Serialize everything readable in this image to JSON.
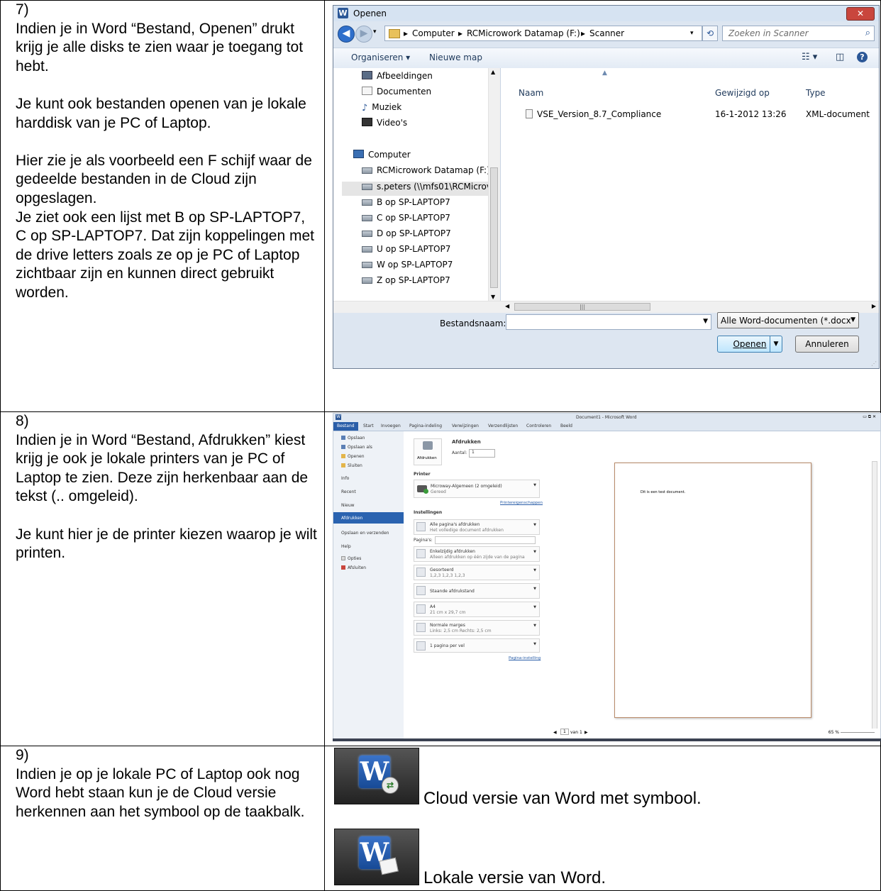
{
  "rows": [
    {
      "number": "7)",
      "paragraphs": [
        "Indien je in Word “Bestand, Openen” drukt krijg je alle disks te zien waar je toegang tot hebt.",
        "Je kunt ook bestanden openen van je lokale harddisk van je PC of Laptop.",
        "Hier zie je als voorbeeld een F schijf waar de gedeelde bestanden in de Cloud zijn opgeslagen.",
        "Je ziet ook een lijst met B op SP-LAPTOP7, C op SP-LAPTOP7. Dat zijn koppelingen met de drive letters zoals ze op je PC of Laptop zichtbaar zijn en kunnen direct gebruikt worden."
      ]
    },
    {
      "number": "8)",
      "paragraphs": [
        "Indien je in Word “Bestand, Afdrukken” kiest krijg je ook je lokale printers van je PC of Laptop te zien. Deze zijn herkenbaar aan de tekst (.. omgeleid).",
        "Je kunt hier je de printer kiezen waarop je wilt printen."
      ]
    },
    {
      "number": "9)",
      "paragraphs": [
        "Indien je op je lokale PC of Laptop ook nog Word hebt staan kun je de Cloud versie herkennen aan het symbool op de taakbalk."
      ]
    }
  ],
  "open_dialog": {
    "app_icon": "W",
    "title": "Openen",
    "close": "✕",
    "breadcrumb": [
      "Computer",
      "RCMicrowork Datamap (F:)",
      "Scanner"
    ],
    "search_placeholder": "Zoeken in Scanner",
    "toolbar": {
      "organize": "Organiseren ▾",
      "new_folder": "Nieuwe map"
    },
    "nav_items": [
      {
        "label": "Afbeeldingen",
        "icon": "pictures-icon"
      },
      {
        "label": "Documenten",
        "icon": "documents-icon"
      },
      {
        "label": "Muziek",
        "icon": "music-icon"
      },
      {
        "label": "Video's",
        "icon": "videos-icon"
      },
      {
        "label": "Computer",
        "icon": "computer-icon"
      },
      {
        "label": "RCMicrowork Datamap (F:)",
        "icon": "network-drive-icon"
      },
      {
        "label": "s.peters (\\\\mfs01\\RCMicrov",
        "icon": "network-drive-icon"
      },
      {
        "label": "B op SP-LAPTOP7",
        "icon": "network-drive-icon"
      },
      {
        "label": "C op SP-LAPTOP7",
        "icon": "network-drive-icon"
      },
      {
        "label": "D op SP-LAPTOP7",
        "icon": "network-drive-icon"
      },
      {
        "label": "U op SP-LAPTOP7",
        "icon": "network-drive-icon"
      },
      {
        "label": "W op SP-LAPTOP7",
        "icon": "network-drive-icon"
      },
      {
        "label": "Z op SP-LAPTOP7",
        "icon": "network-drive-icon"
      }
    ],
    "columns": {
      "name": "Naam",
      "modified": "Gewijzigd op",
      "type": "Type"
    },
    "files": [
      {
        "name": "VSE_Version_8.7_Compliance",
        "modified": "16-1-2012 13:26",
        "type": "XML-document"
      }
    ],
    "filename_label": "Bestandsnaam:",
    "filename_value": "",
    "filter": "Alle Word-documenten (*.docx",
    "open_button": "Openen",
    "cancel_button": "Annuleren"
  },
  "word_print": {
    "window_title": "Document1 - Microsoft Word",
    "tabs": [
      "Bestand",
      "Start",
      "Invoegen",
      "Pagina-indeling",
      "Verwijzingen",
      "Verzendlijsten",
      "Controleren",
      "Beeld"
    ],
    "side_items": [
      "Opslaan",
      "Opslaan als",
      "Openen",
      "Sluiten",
      "Info",
      "Recent",
      "Nieuw",
      "Afdrukken",
      "Opslaan en verzenden",
      "Help",
      "Opties",
      "Afsluiten"
    ],
    "print_heading": "Afdrukken",
    "print_button": "Afdrukken",
    "copies_label": "Aantal:",
    "copies_value": "1",
    "printer_heading": "Printer",
    "printer_name": "Microway-Algemeen (2 omgeleid)",
    "printer_status": "Gereed",
    "printer_props": "Printereigenschappen",
    "settings_heading": "Instellingen",
    "settings": [
      {
        "title": "Alle pagina's afdrukken",
        "sub": "Het volledige document afdrukken"
      },
      {
        "title": "Enkelzijdig afdrukken",
        "sub": "Alleen afdrukken op één zijde van de pagina"
      },
      {
        "title": "Gesorteerd",
        "sub": "1,2,3   1,2,3   1,2,3"
      },
      {
        "title": "Staande afdrukstand",
        "sub": ""
      },
      {
        "title": "A4",
        "sub": "21 cm x 29,7 cm"
      },
      {
        "title": "Normale marges",
        "sub": "Links: 2,5 cm   Rechts: 2,5 cm"
      },
      {
        "title": "1 pagina per vel",
        "sub": ""
      }
    ],
    "pages_label": "Pagina's:",
    "page_setup": "Pagina-instelling",
    "preview_text": "Dit is een test document.",
    "page_nav": "1",
    "page_of": "van 1",
    "zoom": "65 %"
  },
  "icons": {
    "cloud_caption": "Cloud versie van Word met symbool.",
    "local_caption": "Lokale versie van Word.",
    "tile_letter": "W"
  }
}
